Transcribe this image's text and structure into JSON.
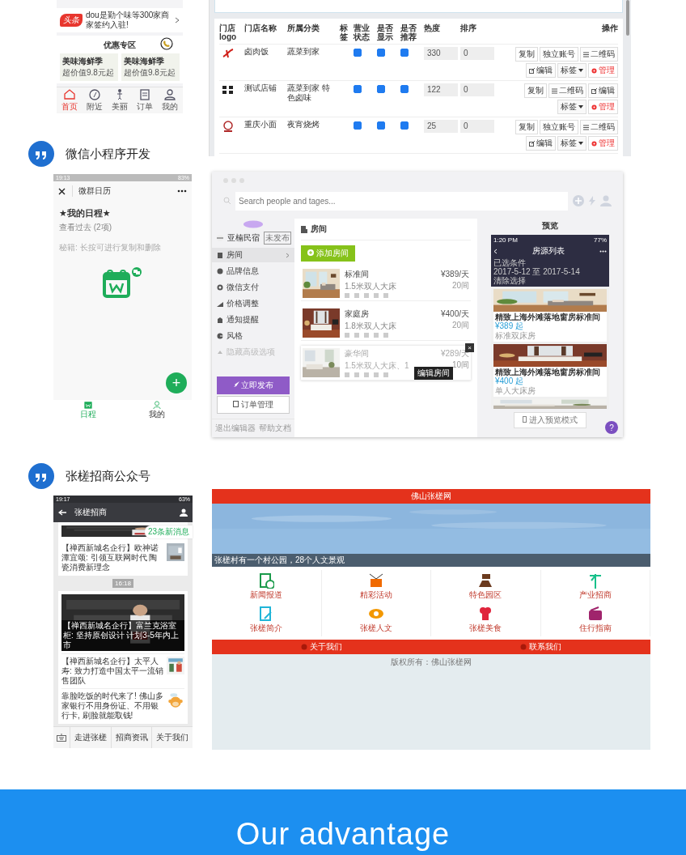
{
  "promo_phone": {
    "notice": {
      "badge": "头条",
      "text": "dou是勤个味等300家商家签约入驻!"
    },
    "section_title": "优惠专区",
    "deals": [
      {
        "title": "美味海鲜季",
        "subtitle": "超价值9.8元起"
      },
      {
        "title": "美味海鲜季",
        "subtitle": "超价值9.8元起"
      }
    ],
    "tabs": [
      {
        "label": "首页",
        "selected": true
      },
      {
        "label": "附近",
        "selected": false
      },
      {
        "label": "美丽",
        "selected": false
      },
      {
        "label": "订单",
        "selected": false
      },
      {
        "label": "我的",
        "selected": false
      }
    ]
  },
  "store_admin": {
    "columns": [
      "门店logo",
      "门店名称",
      "所属分类",
      "标签",
      "营业状态",
      "是否显示",
      "是否推荐",
      "热度",
      "排序",
      "操作"
    ],
    "rows": [
      {
        "name": "卤肉饭",
        "category": "蔬菜到家",
        "open": true,
        "shown": true,
        "recommended": true,
        "heat": "330",
        "order": "0",
        "actions": [
          {
            "label": "复制",
            "kind": "plain"
          },
          {
            "label": "独立账号",
            "kind": "plain"
          },
          {
            "label": "二维码",
            "kind": "qr"
          },
          {
            "label": "编辑",
            "kind": "edit"
          },
          {
            "label": "标签",
            "kind": "dropdown"
          },
          {
            "label": "管理",
            "kind": "danger"
          }
        ]
      },
      {
        "name": "测试店铺",
        "category": "蔬菜到家 特色卤味",
        "open": true,
        "shown": true,
        "recommended": true,
        "heat": "122",
        "order": "0",
        "actions": [
          {
            "label": "复制",
            "kind": "plain"
          },
          {
            "label": "二维码",
            "kind": "qr"
          },
          {
            "label": "编辑",
            "kind": "edit"
          },
          {
            "label": "标签",
            "kind": "dropdown"
          },
          {
            "label": "管理",
            "kind": "danger"
          }
        ]
      },
      {
        "name": "重庆小面",
        "category": "夜宵烧烤",
        "open": true,
        "shown": true,
        "recommended": true,
        "heat": "25",
        "order": "0",
        "actions": [
          {
            "label": "复制",
            "kind": "plain"
          },
          {
            "label": "独立账号",
            "kind": "plain"
          },
          {
            "label": "二维码",
            "kind": "qr"
          },
          {
            "label": "编辑",
            "kind": "edit"
          },
          {
            "label": "标签",
            "kind": "dropdown"
          },
          {
            "label": "管理",
            "kind": "danger"
          }
        ]
      }
    ]
  },
  "mini_program_heading": "微信小程序开发",
  "calendar_app": {
    "status_time": "19:13",
    "battery": "83%",
    "title": "微群日历",
    "schedule_title": "★我的日程★",
    "past_link": "查看过去 (2项)",
    "tip": "秘籍: 长按可进行复制和删除",
    "add_symbol": "+",
    "tabs": [
      {
        "label": "日程",
        "selected": true
      },
      {
        "label": "我的",
        "selected": false
      }
    ]
  },
  "room_editor": {
    "search_placeholder": "Search people and tages...",
    "store_name": "亚楠民宿",
    "store_badge": "未发布",
    "menu": [
      {
        "label": "房间",
        "selected": true,
        "disabled": false
      },
      {
        "label": "品牌信息",
        "selected": false,
        "disabled": false
      },
      {
        "label": "微信支付",
        "selected": false,
        "disabled": false
      },
      {
        "label": "价格调整",
        "selected": false,
        "disabled": false
      },
      {
        "label": "通知提醒",
        "selected": false,
        "disabled": false
      },
      {
        "label": "风格",
        "selected": false,
        "disabled": false
      },
      {
        "label": "隐藏高级选项",
        "selected": false,
        "disabled": true
      }
    ],
    "publish_button": "立即发布",
    "orders_button": "订单管理",
    "footer_links": [
      "退出编辑器",
      "帮助文档"
    ],
    "section_title": "房间",
    "add_button": "添加房间",
    "rooms": [
      {
        "name": "标准间",
        "bed": "1.5米双人大床",
        "price": "¥389/天",
        "count": "20间",
        "hovered": false
      },
      {
        "name": "家庭房",
        "bed": "1.8米双人大床",
        "price": "¥400/天",
        "count": "20间",
        "hovered": false
      },
      {
        "name": "豪华间",
        "bed": "1.5米双人大床、1",
        "price": "¥289/天",
        "count": "10间",
        "hovered": true
      }
    ],
    "tooltip": "编辑房间",
    "close_symbol": "×",
    "preview": {
      "title": "预览",
      "status_time": "1:20 PM",
      "battery": "77%",
      "screen_title": "房源列表",
      "filter_label": "已选条件",
      "dates": "2017-5-12 至 2017-5-14",
      "clear": "清除选择",
      "listings": [
        {
          "title": "精致上海外滩落地窗房标准间",
          "price": "¥389 起",
          "subtitle": "标准双床房"
        },
        {
          "title": "精致上海外滩落地窗房标准间",
          "price": "¥400 起",
          "subtitle": "单人大床房"
        }
      ],
      "mode_button": "进入预览模式"
    },
    "help": "?"
  },
  "official_account_heading": "张槎招商公众号",
  "account_phone": {
    "status_time": "19:17",
    "battery": "63%",
    "title": "张槎招商",
    "first_article": "【禅西新城名企行】欧神诺潭宜颂: 引领互联网时代 陶瓷消费新理念",
    "new_messages": "23条新消息",
    "time": "16:18",
    "lead_caption": "【禅西新城名企行】富兰克浴室柜: 坚持原创设计 计划3-5年内上市",
    "articles": [
      {
        "title": "【禅西新城名企行】太平人寿: 致力打造中国太平一流销售团队"
      },
      {
        "title": "靠脸吃饭的时代来了! 佛山多家银行不用身份证、不用银行卡, 刷脸就能取钱!"
      }
    ],
    "menu": [
      "走进张槎",
      "招商资讯",
      "关于我们"
    ]
  },
  "town_site": {
    "title": "佛山张槎网",
    "banner_caption": "张槎村有一个村公园，28个人文景观",
    "tiles": [
      {
        "label": "新闻报道",
        "color": "#1a9a4a"
      },
      {
        "label": "精彩活动",
        "color": "#f06a00"
      },
      {
        "label": "特色园区",
        "color": "#6b3a1e"
      },
      {
        "label": "产业招商",
        "color": "#17c08a"
      },
      {
        "label": "张槎简介",
        "color": "#20b5d8"
      },
      {
        "label": "张槎人文",
        "color": "#f39800"
      },
      {
        "label": "张槎美食",
        "color": "#e0243c"
      },
      {
        "label": "住行指南",
        "color": "#a0246c"
      }
    ],
    "footer_links": [
      "关于我们",
      "联系我们"
    ],
    "copyright": "版权所有：佛山张槎网"
  },
  "banner": {
    "title": "Our advantage"
  }
}
